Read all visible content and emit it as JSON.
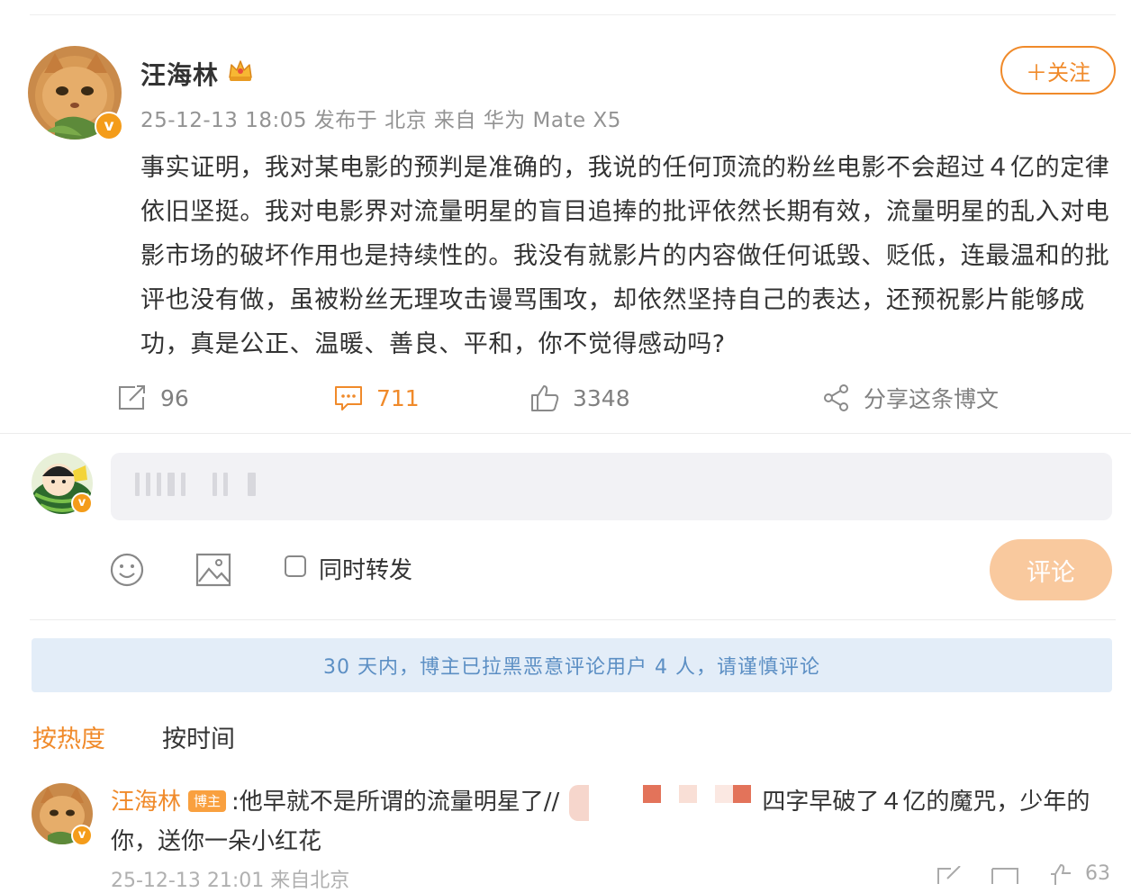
{
  "post": {
    "author": "汪海林",
    "meta": "25-12-13 18:05 发布于 北京  来自 华为 Mate X5",
    "follow_label": "＋关注",
    "body": "事实证明，我对某电影的预判是准确的，我说的任何顶流的粉丝电影不会超过４亿的定律依旧坚挺。我对电影界对流量明星的盲目追捧的批评依然长期有效，流量明星的乱入对电影市场的破坏作用也是持续性的。我没有就影片的内容做任何诋毁、贬低，连最温和的批评也没有做，虽被粉丝无理攻击谩骂围攻，却依然坚持自己的表达，还预祝影片能够成功，真是公正、温暖、善良、平和，你不觉得感动吗?",
    "repost_count": "96",
    "comment_count": "711",
    "like_count": "3348",
    "share_label": "分享这条博文"
  },
  "composer": {
    "forward_label": "同时转发",
    "submit_label": "评论"
  },
  "notice": "30 天内，博主已拉黑恶意评论用户 4 人，请谨慎评论",
  "sort_tabs": [
    "按热度",
    "按时间"
  ],
  "comment": {
    "author": "汪海林",
    "tag": "博主",
    "text_before": ":他早就不是所谓的流量明星了//",
    "text_after": "四字早破了４亿的魔咒，少年的你，送你一朵小红花",
    "meta": "25-12-13 21:01 来自北京",
    "like_count": "63"
  },
  "colors": {
    "accent": "#f08a2a",
    "notice_bg": "#e3edf8",
    "notice_text": "#5c8fc4",
    "submit_disabled": "#f9c99e",
    "verified_badge": "#f49c1a"
  },
  "icons": [
    "crown-icon",
    "verified-icon",
    "repost-icon",
    "comment-icon",
    "like-icon",
    "share-icon",
    "emoji-icon",
    "image-icon"
  ]
}
